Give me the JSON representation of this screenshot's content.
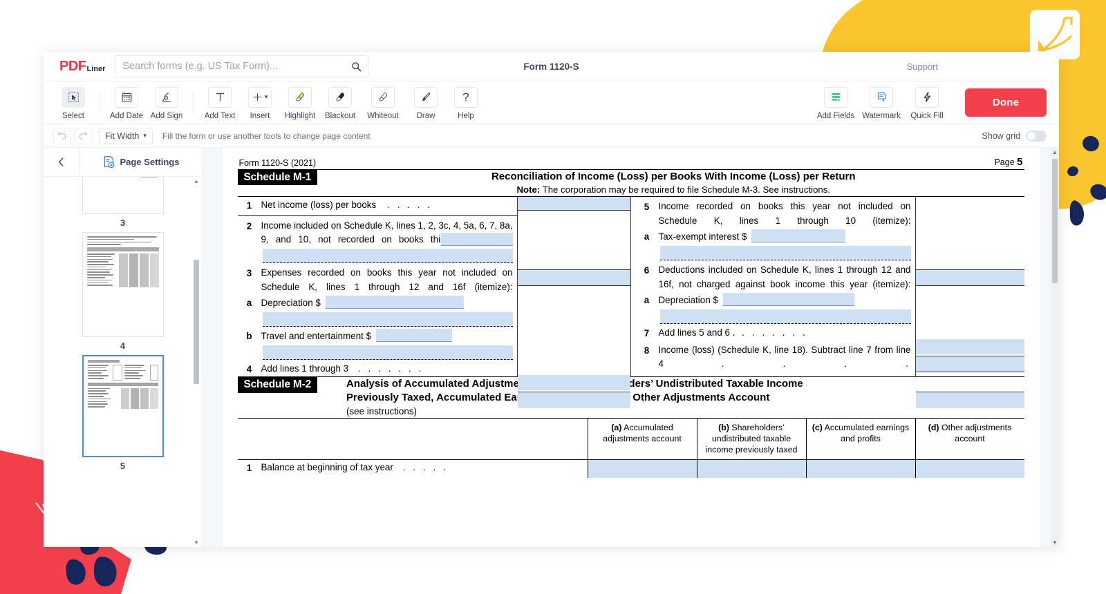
{
  "brand": {
    "name_p": "P",
    "name_d": "D",
    "name_f": "F",
    "suffix": "Liner"
  },
  "header": {
    "search_placeholder": "Search forms (e.g. US Tax Form)...",
    "search_value": "",
    "doc_title": "Form 1120-S",
    "support_label": "Support"
  },
  "toolbar": {
    "tools": [
      {
        "label": "Select",
        "icon": "cursor-select-icon",
        "active": true
      },
      {
        "label": "Add Date",
        "icon": "calendar-icon",
        "active": false
      },
      {
        "label": "Add Sign",
        "icon": "signature-icon",
        "active": false
      },
      {
        "label": "Add Text",
        "icon": "text-t-icon",
        "active": false
      },
      {
        "label": "Insert",
        "icon": "plus-icon",
        "active": false
      },
      {
        "label": "Highlight",
        "icon": "highlighter-icon",
        "active": false
      },
      {
        "label": "Blackout",
        "icon": "blackout-brush-icon",
        "active": false
      },
      {
        "label": "Whiteout",
        "icon": "whiteout-brush-icon",
        "active": false
      },
      {
        "label": "Draw",
        "icon": "paintbrush-icon",
        "active": false
      },
      {
        "label": "Help",
        "icon": "question-mark-icon",
        "active": false
      }
    ],
    "right_tools": [
      {
        "label": "Add Fields",
        "icon": "add-fields-icon"
      },
      {
        "label": "Watermark",
        "icon": "watermark-icon"
      },
      {
        "label": "Quick Fill",
        "icon": "lightning-bolt-icon"
      }
    ],
    "done_label": "Done"
  },
  "subbar": {
    "zoom_label": "Fit Width",
    "hint": "Fill the form or use another tools to change page content",
    "show_grid_label": "Show grid",
    "show_grid_on": false
  },
  "sidebar": {
    "page_settings_label": "Page Settings",
    "thumbnails": [
      {
        "number": "3",
        "selected": false
      },
      {
        "number": "4",
        "selected": false
      },
      {
        "number": "5",
        "selected": true
      }
    ]
  },
  "document": {
    "form_header": "Form 1120-S (2021)",
    "page_label": "Page",
    "page_number": "5",
    "schedule_m1": {
      "tag": "Schedule M-1",
      "title": "Reconciliation of Income (Loss) per Books With Income (Loss) per Return",
      "note_bold": "Note:",
      "note": " The corporation may be required to file Schedule M-3. See instructions.",
      "left_lines": [
        {
          "num": "1",
          "text": "Net income (loss) per books",
          "dots": ".   .   .   .   ."
        },
        {
          "num": "2",
          "text": "Income included on Schedule K, lines 1, 2, 3c, 4, 5a, 6, 7, 8a, 9, and 10, not recorded on books this year (itemize)"
        },
        {
          "num": "3",
          "text": "Expenses recorded on books this year not  included on Schedule K, lines 1 through 12 and 16f (itemize):"
        },
        {
          "num": "a",
          "text": "Depreciation $"
        },
        {
          "num": "b",
          "text": "Travel and entertainment $"
        },
        {
          "num": "4",
          "text": "Add lines 1 through 3",
          "dots": ".   .   .   .   .   .   ."
        }
      ],
      "right_lines": [
        {
          "num": "5",
          "text": "Income recorded on books this year not included on Schedule K, lines 1 through 10 (itemize):"
        },
        {
          "num": "a",
          "text": "Tax-exempt interest $"
        },
        {
          "num": "6",
          "text": "Deductions included on Schedule K, lines 1 through 12 and 16f, not charged against book income this year (itemize):"
        },
        {
          "num": "a",
          "text": "Depreciation $"
        },
        {
          "num": "7",
          "text": "Add lines 5 and 6 .",
          "dots": ".    .    .    .    .    .    ."
        },
        {
          "num": "8",
          "text": "Income (loss) (Schedule K, line 18). Subtract line 7 from line 4",
          "dots": ".   .   .   ."
        }
      ]
    },
    "schedule_m2": {
      "tag": "Schedule M-2",
      "title_line1": "Analysis of Accumulated Adjustments Account, Shareholders’ Undistributed Taxable Income",
      "title_line2": "Previously Taxed, Accumulated Earnings and Profits, and Other Adjustments Account",
      "title_line3": "(see instructions)",
      "columns": [
        {
          "marker": "(a)",
          "text": " Accumulated adjustments account"
        },
        {
          "marker": "(b)",
          "text": " Shareholders’ undistributed taxable income previously taxed"
        },
        {
          "marker": "(c)",
          "text": " Accumulated earnings and profits"
        },
        {
          "marker": "(d)",
          "text": " Other adjustments account"
        }
      ],
      "rows": [
        {
          "num": "1",
          "text": "Balance at beginning of tax year",
          "dots": ".    .    .    .    ."
        }
      ]
    }
  },
  "colors": {
    "accent_red": "#f5404c",
    "field_blue": "#cfe0f5",
    "brand_yellow": "#fbc52d",
    "brand_navy": "#16255c",
    "link_blue": "#7b86c6"
  }
}
